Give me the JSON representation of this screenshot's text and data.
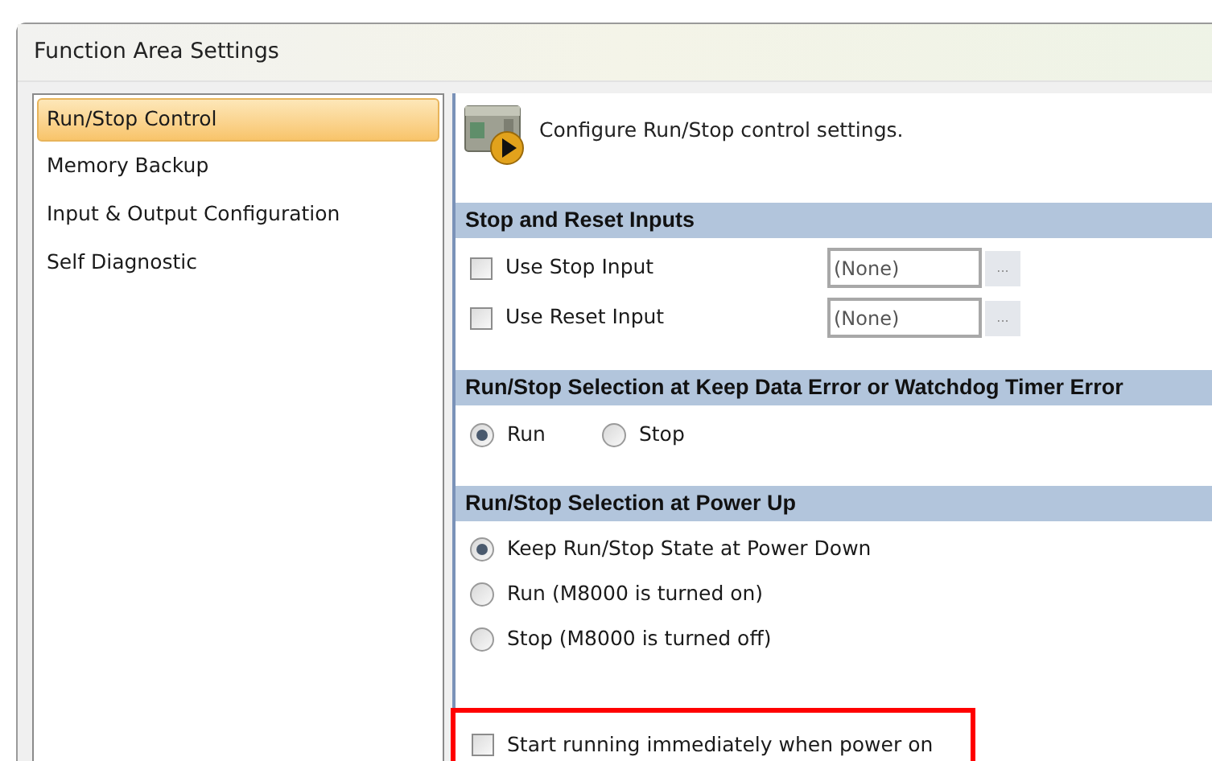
{
  "window": {
    "title": "Function Area Settings"
  },
  "sidebar": {
    "items": [
      {
        "label": "Run/Stop Control",
        "selected": true
      },
      {
        "label": "Memory Backup",
        "selected": false
      },
      {
        "label": "Input & Output Configuration",
        "selected": false
      },
      {
        "label": "Self Diagnostic",
        "selected": false
      }
    ]
  },
  "content": {
    "description": "Configure Run/Stop control settings.",
    "sections": [
      {
        "heading": "Stop and Reset Inputs",
        "highlighted": false,
        "rows": [
          {
            "kind": "checkbox_input",
            "label": "Use Stop Input",
            "checked": false,
            "value": "(None)",
            "button": "..."
          },
          {
            "kind": "checkbox_input",
            "label": "Use Reset Input",
            "checked": false,
            "value": "(None)",
            "button": "..."
          }
        ]
      },
      {
        "heading": "Run/Stop Selection at Keep Data Error or Watchdog Timer Error",
        "highlighted": false,
        "rows": [
          {
            "kind": "radio_group",
            "options": [
              {
                "label": "Run",
                "selected": true
              },
              {
                "label": "Stop",
                "selected": false
              }
            ]
          }
        ]
      },
      {
        "heading": "Run/Stop Selection at Power Up",
        "highlighted": false,
        "rows": [
          {
            "kind": "radio",
            "label": "Keep Run/Stop State at Power Down",
            "selected": true
          },
          {
            "kind": "radio",
            "label": "Run (M8000 is turned on)",
            "selected": false
          },
          {
            "kind": "radio",
            "label": "Stop (M8000 is turned off)",
            "selected": false
          }
        ]
      },
      {
        "highlighted": true,
        "rows": [
          {
            "kind": "checkbox",
            "label": "Start running immediately when power on",
            "checked": false
          }
        ]
      }
    ]
  }
}
